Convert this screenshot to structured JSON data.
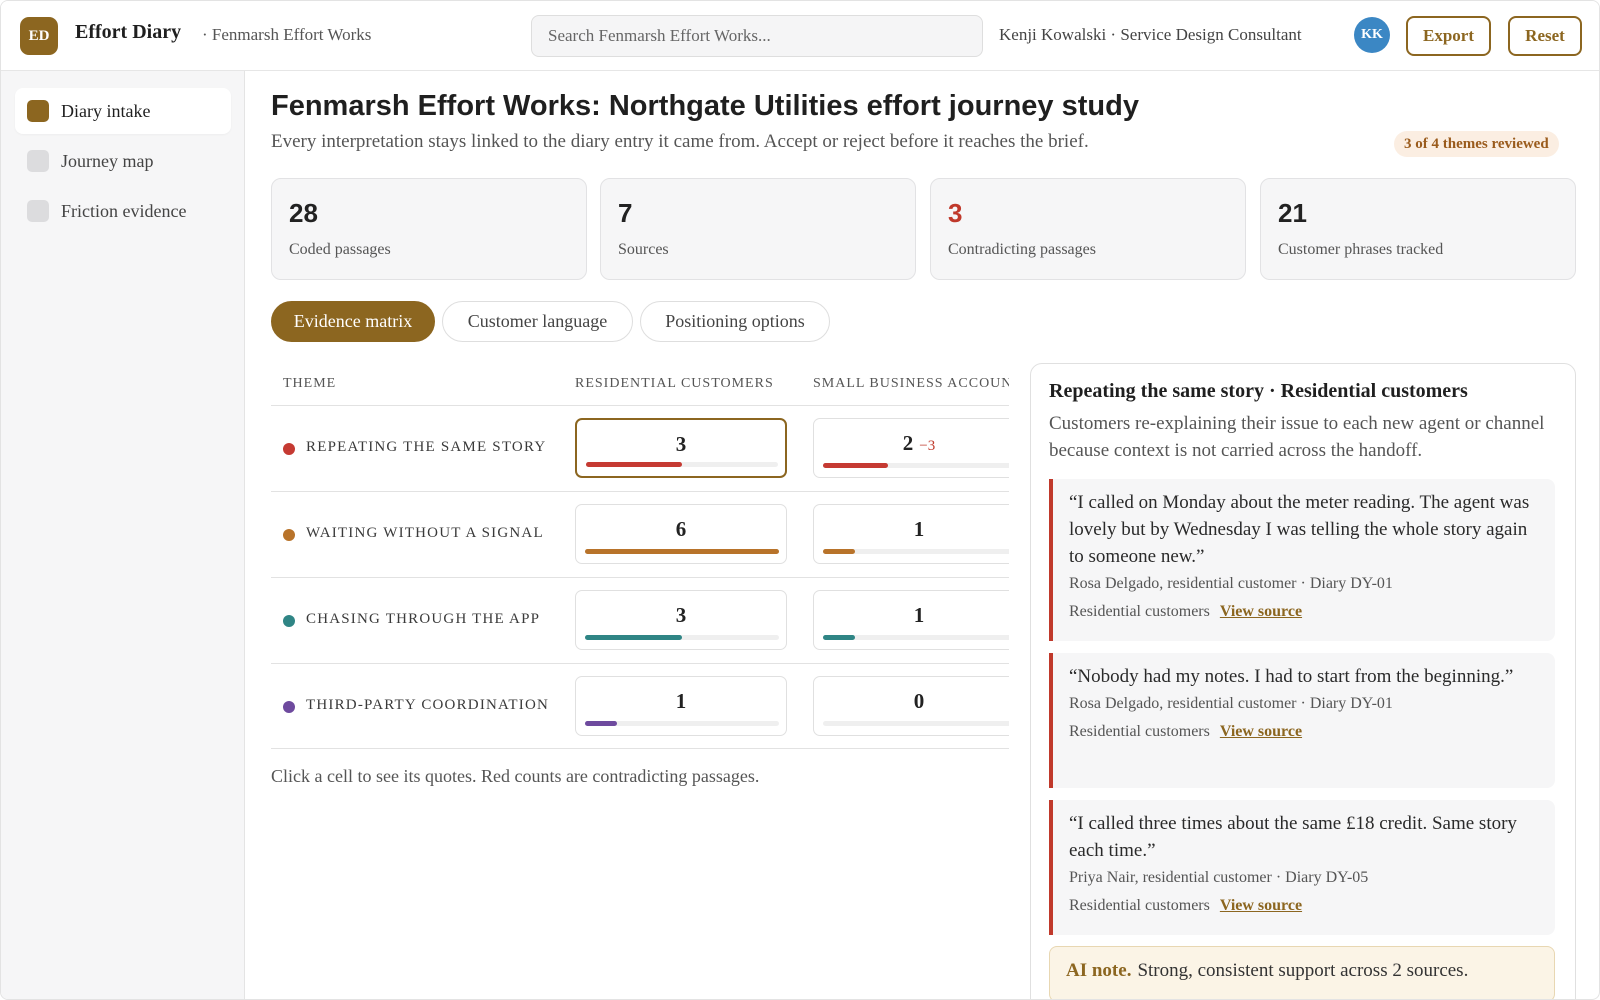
{
  "app": {
    "logo_initials": "ED",
    "name": "Effort Diary",
    "workspace": "· Fenmarsh Effort Works"
  },
  "search": {
    "placeholder": "Search Fenmarsh Effort Works..."
  },
  "user": {
    "display": "Kenji Kowalski · Service Design Consultant",
    "initials": "KK"
  },
  "toolbar": {
    "export_label": "Export",
    "reset_label": "Reset"
  },
  "sidebar": {
    "items": [
      {
        "label": "Diary intake",
        "active": true
      },
      {
        "label": "Journey map",
        "active": false
      },
      {
        "label": "Friction evidence",
        "active": false
      }
    ]
  },
  "page": {
    "title": "Fenmarsh Effort Works: Northgate Utilities effort journey study",
    "description": "Every interpretation stays linked to the diary entry it came from. Accept or reject before it reaches the brief.",
    "review_badge": "3 of 4 themes reviewed"
  },
  "stats": [
    {
      "value": "28",
      "label": "Coded passages",
      "alert": false
    },
    {
      "value": "7",
      "label": "Sources",
      "alert": false
    },
    {
      "value": "3",
      "label": "Contradicting passages",
      "alert": true
    },
    {
      "value": "21",
      "label": "Customer phrases tracked",
      "alert": false
    }
  ],
  "tabs": [
    {
      "label": "Evidence matrix",
      "active": true
    },
    {
      "label": "Customer language",
      "active": false
    },
    {
      "label": "Positioning options",
      "active": false
    }
  ],
  "matrix": {
    "headers": [
      "THEME",
      "RESIDENTIAL CUSTOMERS",
      "SMALL BUSINESS ACCOUNTS"
    ],
    "max_count": 6,
    "rows": [
      {
        "theme": "REPEATING THE SAME STORY",
        "color": "#c53a32",
        "cells": [
          {
            "count": "3",
            "contra": "",
            "level": 0.5,
            "selected": true
          },
          {
            "count": "2",
            "contra": "−3",
            "level": 0.333,
            "selected": false
          }
        ]
      },
      {
        "theme": "WAITING WITHOUT A SIGNAL",
        "color": "#b8732a",
        "cells": [
          {
            "count": "6",
            "contra": "",
            "level": 1.0,
            "selected": false
          },
          {
            "count": "1",
            "contra": "",
            "level": 0.167,
            "selected": false
          }
        ]
      },
      {
        "theme": "CHASING THROUGH THE APP",
        "color": "#2f8585",
        "cells": [
          {
            "count": "3",
            "contra": "",
            "level": 0.5,
            "selected": false
          },
          {
            "count": "1",
            "contra": "",
            "level": 0.167,
            "selected": false
          }
        ]
      },
      {
        "theme": "THIRD-PARTY COORDINATION",
        "color": "#6e4a9e",
        "cells": [
          {
            "count": "1",
            "contra": "",
            "level": 0.167,
            "selected": false
          },
          {
            "count": "0",
            "contra": "",
            "level": 0.0,
            "selected": false
          }
        ]
      }
    ],
    "note": "Click a cell to see its quotes. Red counts are contradicting passages."
  },
  "detail": {
    "title": "Repeating the same story · Residential customers",
    "description": "Customers re-explaining their issue to each new agent or channel because context is not carried across the handoff.",
    "quotes": [
      {
        "text": "“I called on Monday about the meter reading. The agent was lovely but by Wednesday I was telling the whole story again to someone new.”",
        "attribution": "Rosa Delgado, residential customer · Diary DY-01",
        "segment": "Residential customers",
        "link": "View source"
      },
      {
        "text": "“Nobody had my notes. I had to start from the beginning.”",
        "attribution": "Rosa Delgado, residential customer · Diary DY-01",
        "segment": "Residential customers",
        "link": "View source"
      },
      {
        "text": "“I called three times about the same £18 credit. Same story each time.”",
        "attribution": "Priya Nair, residential customer · Diary DY-05",
        "segment": "Residential customers",
        "link": "View source"
      }
    ],
    "ai_label": "AI note.",
    "ai_text": "Strong, consistent support across 2 sources."
  },
  "colors": {
    "accent": "#8c6620",
    "contradiction": "#c0392b",
    "avatar": "#3b87c4"
  }
}
